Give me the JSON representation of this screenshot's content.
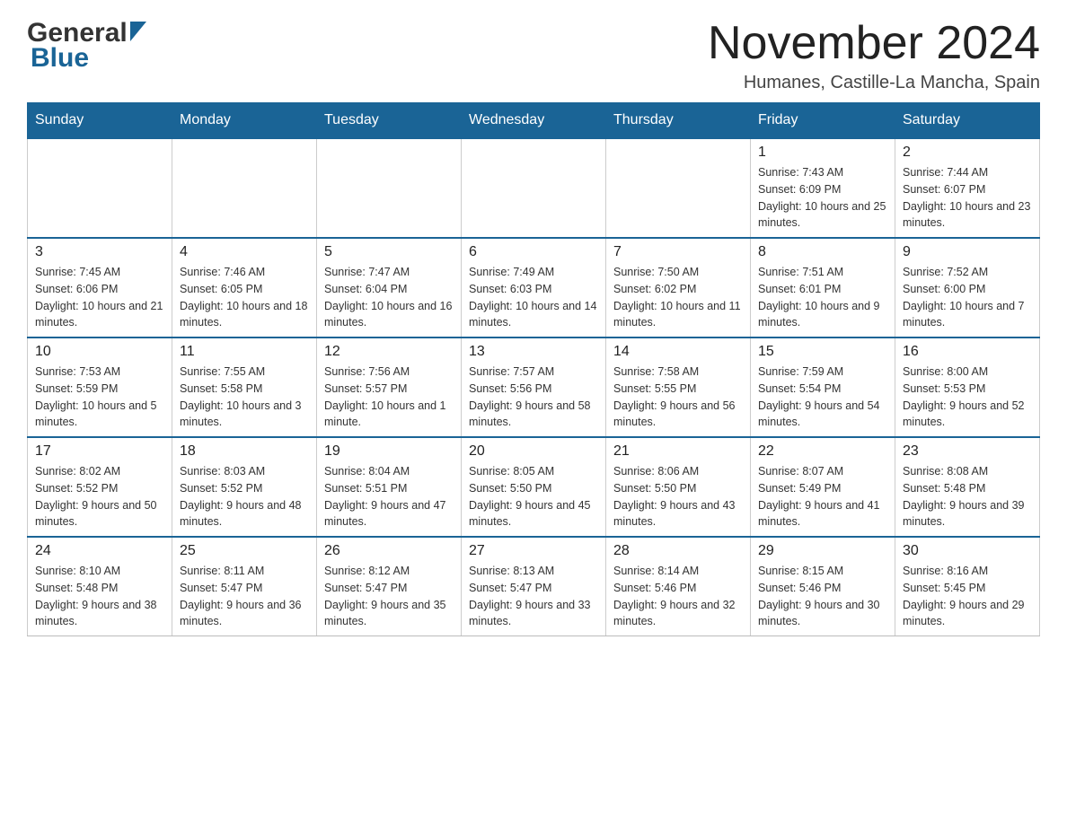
{
  "header": {
    "logo_general": "General",
    "logo_blue": "Blue",
    "month_title": "November 2024",
    "location": "Humanes, Castille-La Mancha, Spain"
  },
  "days_of_week": [
    "Sunday",
    "Monday",
    "Tuesday",
    "Wednesday",
    "Thursday",
    "Friday",
    "Saturday"
  ],
  "weeks": [
    {
      "days": [
        {
          "number": "",
          "info": "",
          "empty": true
        },
        {
          "number": "",
          "info": "",
          "empty": true
        },
        {
          "number": "",
          "info": "",
          "empty": true
        },
        {
          "number": "",
          "info": "",
          "empty": true
        },
        {
          "number": "",
          "info": "",
          "empty": true
        },
        {
          "number": "1",
          "info": "Sunrise: 7:43 AM\nSunset: 6:09 PM\nDaylight: 10 hours and 25 minutes."
        },
        {
          "number": "2",
          "info": "Sunrise: 7:44 AM\nSunset: 6:07 PM\nDaylight: 10 hours and 23 minutes."
        }
      ]
    },
    {
      "days": [
        {
          "number": "3",
          "info": "Sunrise: 7:45 AM\nSunset: 6:06 PM\nDaylight: 10 hours and 21 minutes."
        },
        {
          "number": "4",
          "info": "Sunrise: 7:46 AM\nSunset: 6:05 PM\nDaylight: 10 hours and 18 minutes."
        },
        {
          "number": "5",
          "info": "Sunrise: 7:47 AM\nSunset: 6:04 PM\nDaylight: 10 hours and 16 minutes."
        },
        {
          "number": "6",
          "info": "Sunrise: 7:49 AM\nSunset: 6:03 PM\nDaylight: 10 hours and 14 minutes."
        },
        {
          "number": "7",
          "info": "Sunrise: 7:50 AM\nSunset: 6:02 PM\nDaylight: 10 hours and 11 minutes."
        },
        {
          "number": "8",
          "info": "Sunrise: 7:51 AM\nSunset: 6:01 PM\nDaylight: 10 hours and 9 minutes."
        },
        {
          "number": "9",
          "info": "Sunrise: 7:52 AM\nSunset: 6:00 PM\nDaylight: 10 hours and 7 minutes."
        }
      ]
    },
    {
      "days": [
        {
          "number": "10",
          "info": "Sunrise: 7:53 AM\nSunset: 5:59 PM\nDaylight: 10 hours and 5 minutes."
        },
        {
          "number": "11",
          "info": "Sunrise: 7:55 AM\nSunset: 5:58 PM\nDaylight: 10 hours and 3 minutes."
        },
        {
          "number": "12",
          "info": "Sunrise: 7:56 AM\nSunset: 5:57 PM\nDaylight: 10 hours and 1 minute."
        },
        {
          "number": "13",
          "info": "Sunrise: 7:57 AM\nSunset: 5:56 PM\nDaylight: 9 hours and 58 minutes."
        },
        {
          "number": "14",
          "info": "Sunrise: 7:58 AM\nSunset: 5:55 PM\nDaylight: 9 hours and 56 minutes."
        },
        {
          "number": "15",
          "info": "Sunrise: 7:59 AM\nSunset: 5:54 PM\nDaylight: 9 hours and 54 minutes."
        },
        {
          "number": "16",
          "info": "Sunrise: 8:00 AM\nSunset: 5:53 PM\nDaylight: 9 hours and 52 minutes."
        }
      ]
    },
    {
      "days": [
        {
          "number": "17",
          "info": "Sunrise: 8:02 AM\nSunset: 5:52 PM\nDaylight: 9 hours and 50 minutes."
        },
        {
          "number": "18",
          "info": "Sunrise: 8:03 AM\nSunset: 5:52 PM\nDaylight: 9 hours and 48 minutes."
        },
        {
          "number": "19",
          "info": "Sunrise: 8:04 AM\nSunset: 5:51 PM\nDaylight: 9 hours and 47 minutes."
        },
        {
          "number": "20",
          "info": "Sunrise: 8:05 AM\nSunset: 5:50 PM\nDaylight: 9 hours and 45 minutes."
        },
        {
          "number": "21",
          "info": "Sunrise: 8:06 AM\nSunset: 5:50 PM\nDaylight: 9 hours and 43 minutes."
        },
        {
          "number": "22",
          "info": "Sunrise: 8:07 AM\nSunset: 5:49 PM\nDaylight: 9 hours and 41 minutes."
        },
        {
          "number": "23",
          "info": "Sunrise: 8:08 AM\nSunset: 5:48 PM\nDaylight: 9 hours and 39 minutes."
        }
      ]
    },
    {
      "days": [
        {
          "number": "24",
          "info": "Sunrise: 8:10 AM\nSunset: 5:48 PM\nDaylight: 9 hours and 38 minutes."
        },
        {
          "number": "25",
          "info": "Sunrise: 8:11 AM\nSunset: 5:47 PM\nDaylight: 9 hours and 36 minutes."
        },
        {
          "number": "26",
          "info": "Sunrise: 8:12 AM\nSunset: 5:47 PM\nDaylight: 9 hours and 35 minutes."
        },
        {
          "number": "27",
          "info": "Sunrise: 8:13 AM\nSunset: 5:47 PM\nDaylight: 9 hours and 33 minutes."
        },
        {
          "number": "28",
          "info": "Sunrise: 8:14 AM\nSunset: 5:46 PM\nDaylight: 9 hours and 32 minutes."
        },
        {
          "number": "29",
          "info": "Sunrise: 8:15 AM\nSunset: 5:46 PM\nDaylight: 9 hours and 30 minutes."
        },
        {
          "number": "30",
          "info": "Sunrise: 8:16 AM\nSunset: 5:45 PM\nDaylight: 9 hours and 29 minutes."
        }
      ]
    }
  ]
}
